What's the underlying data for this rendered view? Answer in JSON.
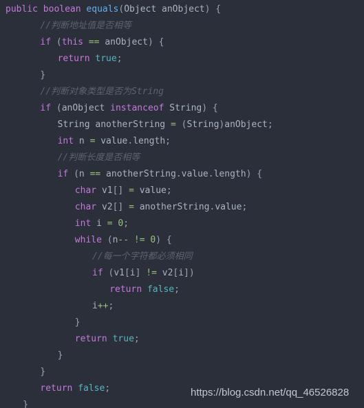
{
  "editor": {
    "background_color": "#2b2f3a",
    "language": "java",
    "font_size_px": 13,
    "line_height_px": 24,
    "colors": {
      "keyword": "#c678dd",
      "method": "#61afef",
      "type": "#a9b7c6",
      "identifier": "#abb2bf",
      "punctuation": "#9aa4b2",
      "operator": "#98c379",
      "number": "#98c379",
      "literal": "#56b6c2",
      "comment": "#5c6370",
      "watermark": "#c3c7ce"
    }
  },
  "code": {
    "lines": [
      {
        "indent": 0,
        "tokens": [
          {
            "t": "public",
            "c": "kw"
          },
          {
            "t": " ",
            "c": "var"
          },
          {
            "t": "boolean",
            "c": "kw"
          },
          {
            "t": " ",
            "c": "var"
          },
          {
            "t": "equals",
            "c": "fn"
          },
          {
            "t": "(",
            "c": "punc"
          },
          {
            "t": "Object",
            "c": "typ"
          },
          {
            "t": " ",
            "c": "var"
          },
          {
            "t": "anObject",
            "c": "var"
          },
          {
            "t": ")",
            "c": "punc"
          },
          {
            "t": " ",
            "c": "var"
          },
          {
            "t": "{",
            "c": "punc"
          }
        ]
      },
      {
        "indent": 2,
        "tokens": [
          {
            "t": "//判断地址值是否相等",
            "c": "cmt"
          }
        ]
      },
      {
        "indent": 2,
        "tokens": [
          {
            "t": "if",
            "c": "kw"
          },
          {
            "t": " ",
            "c": "var"
          },
          {
            "t": "(",
            "c": "punc"
          },
          {
            "t": "this",
            "c": "kw"
          },
          {
            "t": " ",
            "c": "var"
          },
          {
            "t": "==",
            "c": "op"
          },
          {
            "t": " ",
            "c": "var"
          },
          {
            "t": "anObject",
            "c": "var"
          },
          {
            "t": ")",
            "c": "punc"
          },
          {
            "t": " ",
            "c": "var"
          },
          {
            "t": "{",
            "c": "punc"
          }
        ]
      },
      {
        "indent": 3,
        "tokens": [
          {
            "t": "return",
            "c": "kw"
          },
          {
            "t": " ",
            "c": "var"
          },
          {
            "t": "true",
            "c": "lit"
          },
          {
            "t": ";",
            "c": "punc"
          }
        ]
      },
      {
        "indent": 2,
        "tokens": [
          {
            "t": "}",
            "c": "punc"
          }
        ]
      },
      {
        "indent": 2,
        "tokens": [
          {
            "t": "//判断对象类型是否为String",
            "c": "cmt"
          }
        ]
      },
      {
        "indent": 2,
        "tokens": [
          {
            "t": "if",
            "c": "kw"
          },
          {
            "t": " ",
            "c": "var"
          },
          {
            "t": "(",
            "c": "punc"
          },
          {
            "t": "anObject",
            "c": "var"
          },
          {
            "t": " ",
            "c": "var"
          },
          {
            "t": "instanceof",
            "c": "kw"
          },
          {
            "t": " ",
            "c": "var"
          },
          {
            "t": "String",
            "c": "typ"
          },
          {
            "t": ")",
            "c": "punc"
          },
          {
            "t": " ",
            "c": "var"
          },
          {
            "t": "{",
            "c": "punc"
          }
        ]
      },
      {
        "indent": 3,
        "tokens": [
          {
            "t": "String",
            "c": "typ"
          },
          {
            "t": " ",
            "c": "var"
          },
          {
            "t": "anotherString",
            "c": "var"
          },
          {
            "t": " ",
            "c": "var"
          },
          {
            "t": "=",
            "c": "op"
          },
          {
            "t": " ",
            "c": "var"
          },
          {
            "t": "(",
            "c": "punc"
          },
          {
            "t": "String",
            "c": "typ"
          },
          {
            "t": ")",
            "c": "punc"
          },
          {
            "t": "anObject",
            "c": "var"
          },
          {
            "t": ";",
            "c": "punc"
          }
        ]
      },
      {
        "indent": 3,
        "tokens": [
          {
            "t": "int",
            "c": "kw"
          },
          {
            "t": " ",
            "c": "var"
          },
          {
            "t": "n",
            "c": "var"
          },
          {
            "t": " ",
            "c": "var"
          },
          {
            "t": "=",
            "c": "op"
          },
          {
            "t": " ",
            "c": "var"
          },
          {
            "t": "value",
            "c": "typ"
          },
          {
            "t": ".",
            "c": "punc"
          },
          {
            "t": "length",
            "c": "var"
          },
          {
            "t": ";",
            "c": "punc"
          }
        ]
      },
      {
        "indent": 3,
        "tokens": [
          {
            "t": "//判断长度是否相等",
            "c": "cmt"
          }
        ]
      },
      {
        "indent": 3,
        "tokens": [
          {
            "t": "if",
            "c": "kw"
          },
          {
            "t": " ",
            "c": "var"
          },
          {
            "t": "(",
            "c": "punc"
          },
          {
            "t": "n",
            "c": "var"
          },
          {
            "t": " ",
            "c": "var"
          },
          {
            "t": "==",
            "c": "op"
          },
          {
            "t": " ",
            "c": "var"
          },
          {
            "t": "anotherString",
            "c": "var"
          },
          {
            "t": ".",
            "c": "punc"
          },
          {
            "t": "value",
            "c": "var"
          },
          {
            "t": ".",
            "c": "punc"
          },
          {
            "t": "length",
            "c": "var"
          },
          {
            "t": ")",
            "c": "punc"
          },
          {
            "t": " ",
            "c": "var"
          },
          {
            "t": "{",
            "c": "punc"
          }
        ]
      },
      {
        "indent": 4,
        "tokens": [
          {
            "t": "char",
            "c": "kw"
          },
          {
            "t": " ",
            "c": "var"
          },
          {
            "t": "v1",
            "c": "var"
          },
          {
            "t": "[]",
            "c": "punc"
          },
          {
            "t": " ",
            "c": "var"
          },
          {
            "t": "=",
            "c": "op"
          },
          {
            "t": " ",
            "c": "var"
          },
          {
            "t": "value",
            "c": "typ"
          },
          {
            "t": ";",
            "c": "punc"
          }
        ]
      },
      {
        "indent": 4,
        "tokens": [
          {
            "t": "char",
            "c": "kw"
          },
          {
            "t": " ",
            "c": "var"
          },
          {
            "t": "v2",
            "c": "var"
          },
          {
            "t": "[]",
            "c": "punc"
          },
          {
            "t": " ",
            "c": "var"
          },
          {
            "t": "=",
            "c": "op"
          },
          {
            "t": " ",
            "c": "var"
          },
          {
            "t": "anotherString",
            "c": "var"
          },
          {
            "t": ".",
            "c": "punc"
          },
          {
            "t": "value",
            "c": "typ"
          },
          {
            "t": ";",
            "c": "punc"
          }
        ]
      },
      {
        "indent": 4,
        "tokens": [
          {
            "t": "int",
            "c": "kw"
          },
          {
            "t": " ",
            "c": "var"
          },
          {
            "t": "i",
            "c": "var"
          },
          {
            "t": " ",
            "c": "var"
          },
          {
            "t": "=",
            "c": "op"
          },
          {
            "t": " ",
            "c": "var"
          },
          {
            "t": "0",
            "c": "num"
          },
          {
            "t": ";",
            "c": "punc"
          }
        ]
      },
      {
        "indent": 4,
        "tokens": [
          {
            "t": "while",
            "c": "kw"
          },
          {
            "t": " ",
            "c": "var"
          },
          {
            "t": "(",
            "c": "punc"
          },
          {
            "t": "n",
            "c": "var"
          },
          {
            "t": "--",
            "c": "op"
          },
          {
            "t": " ",
            "c": "var"
          },
          {
            "t": "!=",
            "c": "op"
          },
          {
            "t": " ",
            "c": "var"
          },
          {
            "t": "0",
            "c": "num"
          },
          {
            "t": ")",
            "c": "punc"
          },
          {
            "t": " ",
            "c": "var"
          },
          {
            "t": "{",
            "c": "punc"
          }
        ]
      },
      {
        "indent": 5,
        "tokens": [
          {
            "t": "//每一个字符都必须相同",
            "c": "cmt"
          }
        ]
      },
      {
        "indent": 5,
        "tokens": [
          {
            "t": "if",
            "c": "kw"
          },
          {
            "t": " ",
            "c": "var"
          },
          {
            "t": "(",
            "c": "punc"
          },
          {
            "t": "v1",
            "c": "var"
          },
          {
            "t": "[",
            "c": "punc"
          },
          {
            "t": "i",
            "c": "var"
          },
          {
            "t": "]",
            "c": "punc"
          },
          {
            "t": " ",
            "c": "var"
          },
          {
            "t": "!=",
            "c": "op"
          },
          {
            "t": " ",
            "c": "var"
          },
          {
            "t": "v2",
            "c": "var"
          },
          {
            "t": "[",
            "c": "punc"
          },
          {
            "t": "i",
            "c": "var"
          },
          {
            "t": "]",
            "c": "punc"
          },
          {
            "t": ")",
            "c": "punc"
          }
        ]
      },
      {
        "indent": 6,
        "tokens": [
          {
            "t": "return",
            "c": "kw"
          },
          {
            "t": " ",
            "c": "var"
          },
          {
            "t": "false",
            "c": "lit"
          },
          {
            "t": ";",
            "c": "punc"
          }
        ]
      },
      {
        "indent": 5,
        "tokens": [
          {
            "t": "i",
            "c": "var"
          },
          {
            "t": "++",
            "c": "op"
          },
          {
            "t": ";",
            "c": "punc"
          }
        ]
      },
      {
        "indent": 4,
        "tokens": [
          {
            "t": "}",
            "c": "punc"
          }
        ]
      },
      {
        "indent": 4,
        "tokens": [
          {
            "t": "return",
            "c": "kw"
          },
          {
            "t": " ",
            "c": "var"
          },
          {
            "t": "true",
            "c": "lit"
          },
          {
            "t": ";",
            "c": "punc"
          }
        ]
      },
      {
        "indent": 3,
        "tokens": [
          {
            "t": "}",
            "c": "punc"
          }
        ]
      },
      {
        "indent": 2,
        "tokens": [
          {
            "t": "}",
            "c": "punc"
          }
        ]
      },
      {
        "indent": 2,
        "tokens": [
          {
            "t": "return",
            "c": "kw"
          },
          {
            "t": " ",
            "c": "var"
          },
          {
            "t": "false",
            "c": "lit"
          },
          {
            "t": ";",
            "c": "punc"
          }
        ]
      },
      {
        "indent": 1,
        "tokens": [
          {
            "t": "}",
            "c": "punc"
          }
        ]
      }
    ]
  },
  "watermark": {
    "text": "https://blog.csdn.net/qq_46526828"
  }
}
